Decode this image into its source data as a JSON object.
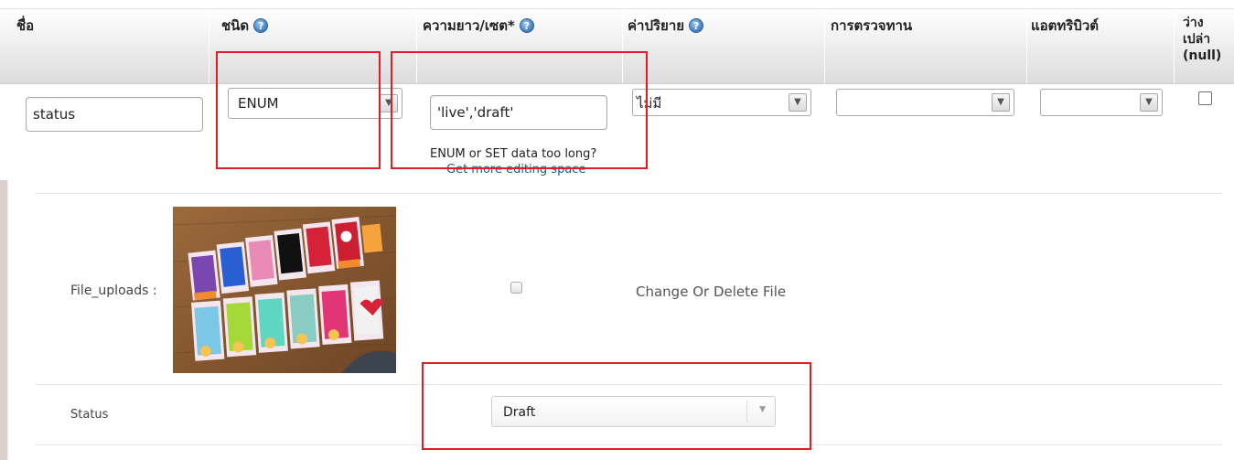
{
  "structure_table": {
    "columns": {
      "name": "ชื่อ",
      "type": "ชนิด",
      "length": "ความยาว/เซต*",
      "default": "ค่าปริยาย",
      "collation": "การตรวจทาน",
      "attributes": "แอตทริบิวต์",
      "null_line1": "ว่าง",
      "null_line2": "เปล่า",
      "null_line3": "(null)"
    },
    "row": {
      "name_value": "status",
      "type_value": "ENUM",
      "length_value": "'live','draft'",
      "default_value": "ไม่มี",
      "collation_value": "",
      "attributes_value": "",
      "enum_hint": "ENUM or SET data too long?",
      "enum_link": "Get more editing space"
    }
  },
  "form": {
    "file_label": "File_uploads :",
    "change_label": "Change Or Delete File",
    "status_label": "Status",
    "status_value": "Draft"
  },
  "icons": {
    "help": "help-icon",
    "dropdown": "chevron-down-icon"
  },
  "colors": {
    "highlight": "#e31b23",
    "link": "#235a81"
  }
}
